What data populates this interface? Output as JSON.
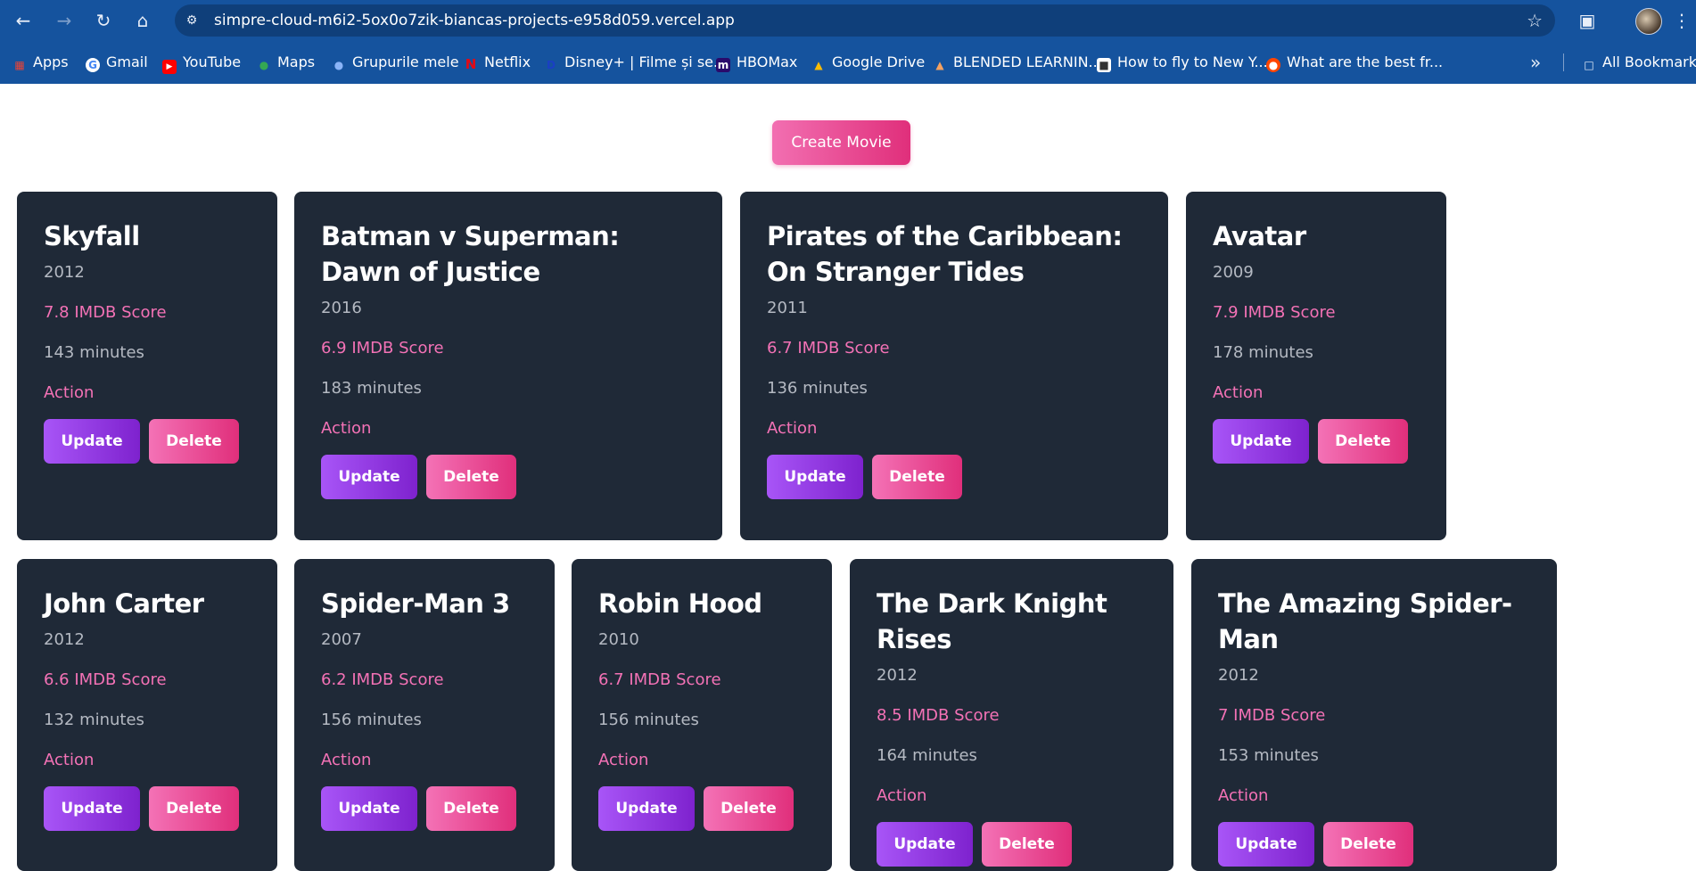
{
  "browser": {
    "url": "simpre-cloud-m6i2-5ox0o7zik-biancas-projects-e958d059.vercel.app",
    "bookmarks": [
      "Apps",
      "Gmail",
      "YouTube",
      "Maps",
      "Grupurile mele",
      "Netflix",
      "Disney+ | Filme și se...",
      "HBOMax",
      "Google Drive",
      "BLENDED LEARNIN...",
      "How to fly to New Y...",
      "What are the best fr...",
      "All Bookmarks"
    ]
  },
  "page": {
    "create_label": "Create Movie",
    "update_label": "Update",
    "delete_label": "Delete"
  },
  "movies": [
    {
      "title": "Skyfall",
      "year": "2012",
      "score": "7.8 IMDB Score",
      "minutes": "143 minutes",
      "genre": "Action"
    },
    {
      "title": "Batman v Superman: Dawn of Justice",
      "year": "2016",
      "score": "6.9 IMDB Score",
      "minutes": "183 minutes",
      "genre": "Action"
    },
    {
      "title": "Pirates of the Caribbean: On Stranger Tides",
      "year": "2011",
      "score": "6.7 IMDB Score",
      "minutes": "136 minutes",
      "genre": "Action"
    },
    {
      "title": "Avatar",
      "year": "2009",
      "score": "7.9 IMDB Score",
      "minutes": "178 minutes",
      "genre": "Action"
    },
    {
      "title": "John Carter",
      "year": "2012",
      "score": "6.6 IMDB Score",
      "minutes": "132 minutes",
      "genre": "Action"
    },
    {
      "title": "Spider-Man 3",
      "year": "2007",
      "score": "6.2 IMDB Score",
      "minutes": "156 minutes",
      "genre": "Action"
    },
    {
      "title": "Robin Hood",
      "year": "2010",
      "score": "6.7 IMDB Score",
      "minutes": "156 minutes",
      "genre": "Action"
    },
    {
      "title": "The Dark Knight Rises",
      "year": "2012",
      "score": "8.5 IMDB Score",
      "minutes": "164 minutes",
      "genre": "Action"
    },
    {
      "title": "The Amazing Spider-Man",
      "year": "2012",
      "score": "7 IMDB Score",
      "minutes": "153 minutes",
      "genre": "Action"
    }
  ]
}
